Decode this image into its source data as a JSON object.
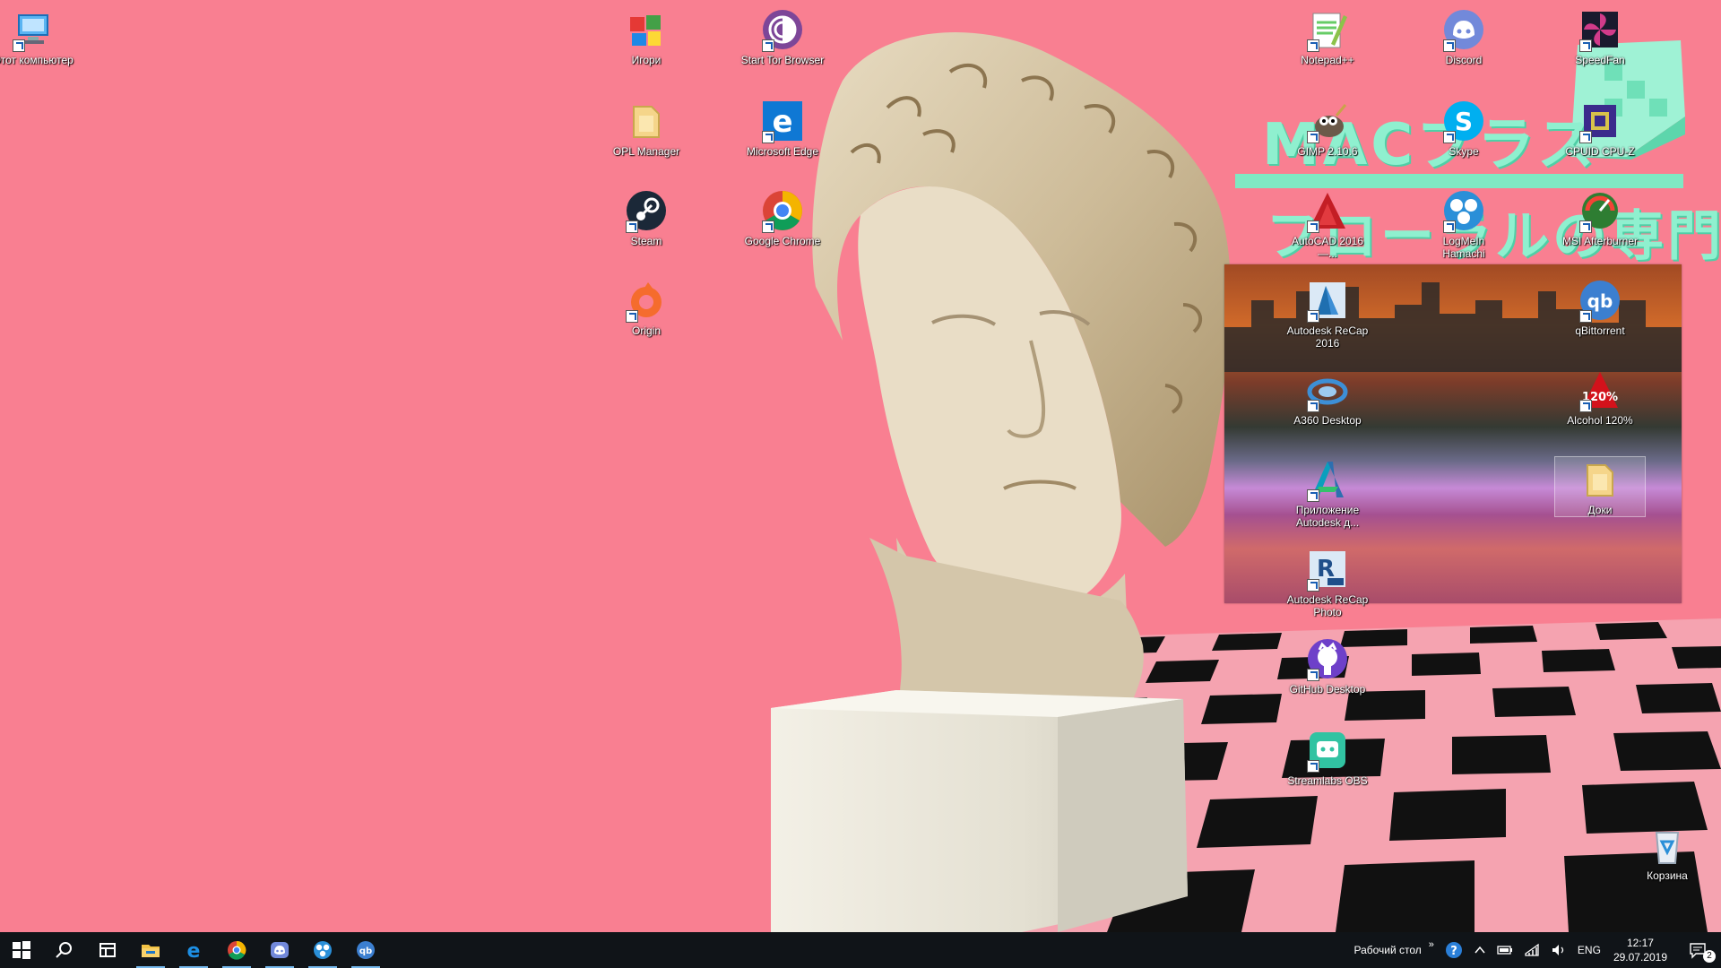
{
  "desktop": {
    "icons": [
      {
        "id": "this-pc",
        "label": "Этот компьютер",
        "icon": "computer-icon"
      },
      {
        "id": "games",
        "label": "Игори",
        "icon": "games-folder-icon"
      },
      {
        "id": "tor",
        "label": "Start Tor Browser",
        "icon": "tor-icon"
      },
      {
        "id": "opl",
        "label": "OPL Manager",
        "icon": "folder-icon"
      },
      {
        "id": "edge",
        "label": "Microsoft Edge",
        "icon": "edge-icon"
      },
      {
        "id": "steam",
        "label": "Steam",
        "icon": "steam-icon"
      },
      {
        "id": "chrome",
        "label": "Google Chrome",
        "icon": "chrome-icon"
      },
      {
        "id": "origin",
        "label": "Origin",
        "icon": "origin-icon"
      },
      {
        "id": "notepad",
        "label": "Notepad++",
        "icon": "notepad-icon"
      },
      {
        "id": "discord",
        "label": "Discord",
        "icon": "discord-icon"
      },
      {
        "id": "speedfan",
        "label": "SpeedFan",
        "icon": "speedfan-icon"
      },
      {
        "id": "gimp",
        "label": "GIMP 2.10.6",
        "icon": "gimp-icon"
      },
      {
        "id": "skype",
        "label": "Skype",
        "icon": "skype-icon"
      },
      {
        "id": "cpuz",
        "label": "CPUID CPU-Z",
        "icon": "cpuz-icon"
      },
      {
        "id": "autocad",
        "label": "AutoCAD 2016 —...",
        "icon": "autocad-icon"
      },
      {
        "id": "hamachi",
        "label": "LogMeIn Hamachi",
        "icon": "hamachi-icon"
      },
      {
        "id": "afterburner",
        "label": "MSI Afterburner",
        "icon": "afterburner-icon"
      },
      {
        "id": "recap2016",
        "label": "Autodesk ReCap 2016",
        "icon": "recap-icon"
      },
      {
        "id": "qbittorrent",
        "label": "qBittorrent",
        "icon": "qbittorrent-icon"
      },
      {
        "id": "a360",
        "label": "A360 Desktop",
        "icon": "a360-icon"
      },
      {
        "id": "alcohol",
        "label": "Alcohol 120%",
        "icon": "alcohol-icon"
      },
      {
        "id": "autodesk-app",
        "label": "Приложение Autodesk д...",
        "icon": "autodesk-icon"
      },
      {
        "id": "docs",
        "label": "Доки",
        "icon": "folder-icon"
      },
      {
        "id": "recap-photo",
        "label": "Autodesk ReCap Photo",
        "icon": "recap-photo-icon"
      },
      {
        "id": "github",
        "label": "GitHub Desktop",
        "icon": "github-icon"
      },
      {
        "id": "streamlabs",
        "label": "Streamlabs OBS",
        "icon": "streamlabs-icon"
      },
      {
        "id": "recycle",
        "label": "Корзина",
        "icon": "recycle-bin-icon"
      }
    ]
  },
  "wallpaper": {
    "line1": "MACプラス",
    "line2": "フローラルの専門店",
    "accent": "#8ff0cf",
    "background": "#f97f91"
  },
  "taskbar": {
    "apps": [
      {
        "name": "start-button",
        "icon": "windows-icon"
      },
      {
        "name": "search-button",
        "icon": "search-icon"
      },
      {
        "name": "task-view-button",
        "icon": "task-view-icon"
      },
      {
        "name": "explorer-button",
        "icon": "folder-icon"
      },
      {
        "name": "edge-button",
        "icon": "edge-icon"
      },
      {
        "name": "chrome-button",
        "icon": "chrome-icon"
      },
      {
        "name": "discord-button",
        "icon": "discord-icon"
      },
      {
        "name": "hamachi-button",
        "icon": "hamachi-icon"
      },
      {
        "name": "qbittorrent-button",
        "icon": "qbittorrent-icon"
      }
    ],
    "desktop_toolbar": "Рабочий стол",
    "chevron": "»",
    "language": "ENG",
    "time": "12:17",
    "date": "29.07.2019",
    "notifications": "2"
  }
}
